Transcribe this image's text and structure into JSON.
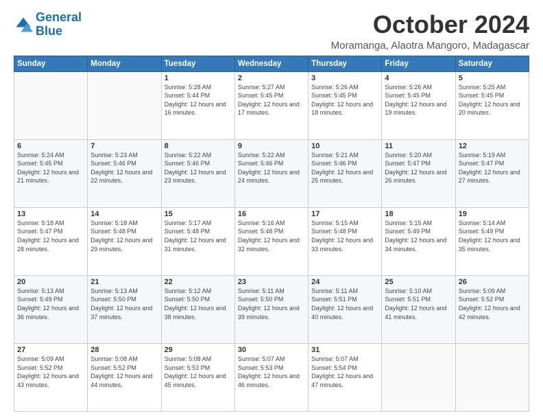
{
  "header": {
    "logo_line1": "General",
    "logo_line2": "Blue",
    "month": "October 2024",
    "location": "Moramanga, Alaotra Mangoro, Madagascar"
  },
  "weekdays": [
    "Sunday",
    "Monday",
    "Tuesday",
    "Wednesday",
    "Thursday",
    "Friday",
    "Saturday"
  ],
  "weeks": [
    [
      {
        "day": "",
        "info": ""
      },
      {
        "day": "",
        "info": ""
      },
      {
        "day": "1",
        "info": "Sunrise: 5:28 AM\nSunset: 5:44 PM\nDaylight: 12 hours and 16 minutes."
      },
      {
        "day": "2",
        "info": "Sunrise: 5:27 AM\nSunset: 5:45 PM\nDaylight: 12 hours and 17 minutes."
      },
      {
        "day": "3",
        "info": "Sunrise: 5:26 AM\nSunset: 5:45 PM\nDaylight: 12 hours and 18 minutes."
      },
      {
        "day": "4",
        "info": "Sunrise: 5:26 AM\nSunset: 5:45 PM\nDaylight: 12 hours and 19 minutes."
      },
      {
        "day": "5",
        "info": "Sunrise: 5:25 AM\nSunset: 5:45 PM\nDaylight: 12 hours and 20 minutes."
      }
    ],
    [
      {
        "day": "6",
        "info": "Sunrise: 5:24 AM\nSunset: 5:45 PM\nDaylight: 12 hours and 21 minutes."
      },
      {
        "day": "7",
        "info": "Sunrise: 5:23 AM\nSunset: 5:46 PM\nDaylight: 12 hours and 22 minutes."
      },
      {
        "day": "8",
        "info": "Sunrise: 5:22 AM\nSunset: 5:46 PM\nDaylight: 12 hours and 23 minutes."
      },
      {
        "day": "9",
        "info": "Sunrise: 5:22 AM\nSunset: 5:46 PM\nDaylight: 12 hours and 24 minutes."
      },
      {
        "day": "10",
        "info": "Sunrise: 5:21 AM\nSunset: 5:46 PM\nDaylight: 12 hours and 25 minutes."
      },
      {
        "day": "11",
        "info": "Sunrise: 5:20 AM\nSunset: 5:47 PM\nDaylight: 12 hours and 26 minutes."
      },
      {
        "day": "12",
        "info": "Sunrise: 5:19 AM\nSunset: 5:47 PM\nDaylight: 12 hours and 27 minutes."
      }
    ],
    [
      {
        "day": "13",
        "info": "Sunrise: 5:18 AM\nSunset: 5:47 PM\nDaylight: 12 hours and 28 minutes."
      },
      {
        "day": "14",
        "info": "Sunrise: 5:18 AM\nSunset: 5:48 PM\nDaylight: 12 hours and 29 minutes."
      },
      {
        "day": "15",
        "info": "Sunrise: 5:17 AM\nSunset: 5:48 PM\nDaylight: 12 hours and 31 minutes."
      },
      {
        "day": "16",
        "info": "Sunrise: 5:16 AM\nSunset: 5:48 PM\nDaylight: 12 hours and 32 minutes."
      },
      {
        "day": "17",
        "info": "Sunrise: 5:15 AM\nSunset: 5:48 PM\nDaylight: 12 hours and 33 minutes."
      },
      {
        "day": "18",
        "info": "Sunrise: 5:15 AM\nSunset: 5:49 PM\nDaylight: 12 hours and 34 minutes."
      },
      {
        "day": "19",
        "info": "Sunrise: 5:14 AM\nSunset: 5:49 PM\nDaylight: 12 hours and 35 minutes."
      }
    ],
    [
      {
        "day": "20",
        "info": "Sunrise: 5:13 AM\nSunset: 5:49 PM\nDaylight: 12 hours and 36 minutes."
      },
      {
        "day": "21",
        "info": "Sunrise: 5:13 AM\nSunset: 5:50 PM\nDaylight: 12 hours and 37 minutes."
      },
      {
        "day": "22",
        "info": "Sunrise: 5:12 AM\nSunset: 5:50 PM\nDaylight: 12 hours and 38 minutes."
      },
      {
        "day": "23",
        "info": "Sunrise: 5:11 AM\nSunset: 5:50 PM\nDaylight: 12 hours and 39 minutes."
      },
      {
        "day": "24",
        "info": "Sunrise: 5:11 AM\nSunset: 5:51 PM\nDaylight: 12 hours and 40 minutes."
      },
      {
        "day": "25",
        "info": "Sunrise: 5:10 AM\nSunset: 5:51 PM\nDaylight: 12 hours and 41 minutes."
      },
      {
        "day": "26",
        "info": "Sunrise: 5:09 AM\nSunset: 5:52 PM\nDaylight: 12 hours and 42 minutes."
      }
    ],
    [
      {
        "day": "27",
        "info": "Sunrise: 5:09 AM\nSunset: 5:52 PM\nDaylight: 12 hours and 43 minutes."
      },
      {
        "day": "28",
        "info": "Sunrise: 5:08 AM\nSunset: 5:52 PM\nDaylight: 12 hours and 44 minutes."
      },
      {
        "day": "29",
        "info": "Sunrise: 5:08 AM\nSunset: 5:53 PM\nDaylight: 12 hours and 45 minutes."
      },
      {
        "day": "30",
        "info": "Sunrise: 5:07 AM\nSunset: 5:53 PM\nDaylight: 12 hours and 46 minutes."
      },
      {
        "day": "31",
        "info": "Sunrise: 5:07 AM\nSunset: 5:54 PM\nDaylight: 12 hours and 47 minutes."
      },
      {
        "day": "",
        "info": ""
      },
      {
        "day": "",
        "info": ""
      }
    ]
  ]
}
